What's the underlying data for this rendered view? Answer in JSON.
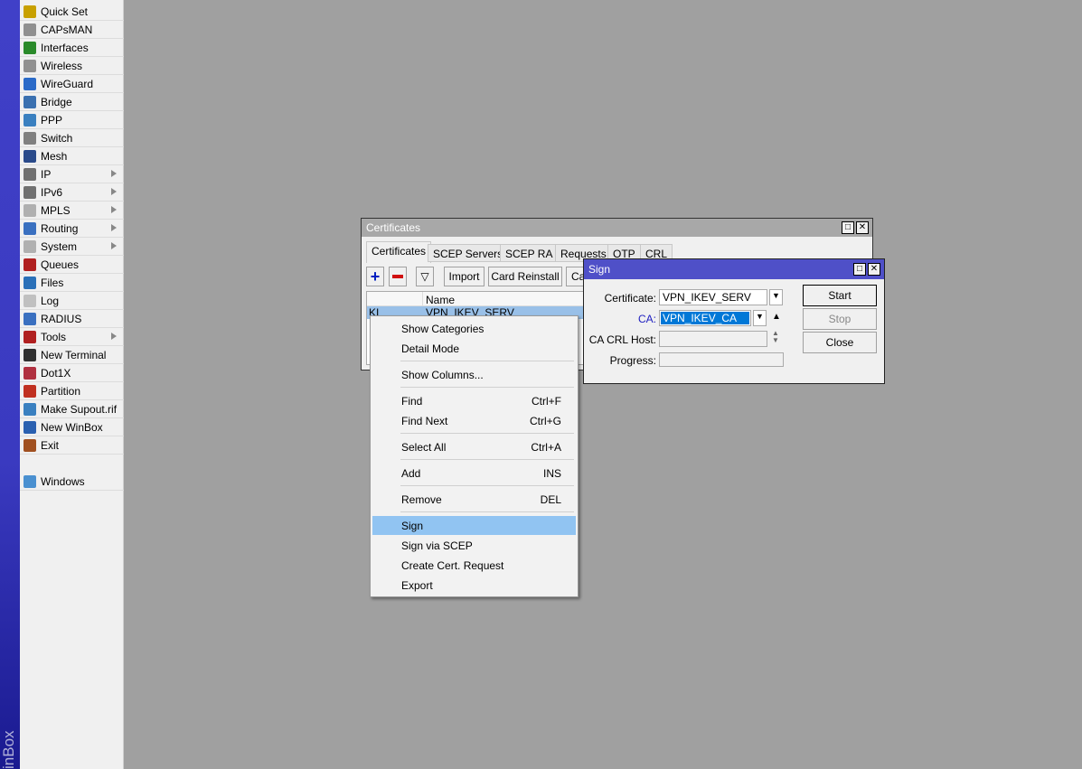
{
  "sidebar": {
    "brand": "inBox",
    "items": [
      {
        "label": "Quick Set",
        "icon": "quick-set-icon",
        "color": "#c8a000",
        "sub": false
      },
      {
        "label": "CAPsMAN",
        "icon": "capsman-icon",
        "color": "#909090",
        "sub": false
      },
      {
        "label": "Interfaces",
        "icon": "interfaces-icon",
        "color": "#2a8a2a",
        "sub": false
      },
      {
        "label": "Wireless",
        "icon": "wireless-icon",
        "color": "#909090",
        "sub": false
      },
      {
        "label": "WireGuard",
        "icon": "wireguard-icon",
        "color": "#2a6ac8",
        "sub": false
      },
      {
        "label": "Bridge",
        "icon": "bridge-icon",
        "color": "#3a70b0",
        "sub": false
      },
      {
        "label": "PPP",
        "icon": "ppp-icon",
        "color": "#3a80c0",
        "sub": false
      },
      {
        "label": "Switch",
        "icon": "switch-icon",
        "color": "#808080",
        "sub": false
      },
      {
        "label": "Mesh",
        "icon": "mesh-icon",
        "color": "#2a4a8a",
        "sub": false
      },
      {
        "label": "IP",
        "icon": "ip-icon",
        "color": "#707070",
        "sub": true
      },
      {
        "label": "IPv6",
        "icon": "ipv6-icon",
        "color": "#707070",
        "sub": true
      },
      {
        "label": "MPLS",
        "icon": "mpls-icon",
        "color": "#b0b0b0",
        "sub": true
      },
      {
        "label": "Routing",
        "icon": "routing-icon",
        "color": "#3a70c0",
        "sub": true
      },
      {
        "label": "System",
        "icon": "system-icon",
        "color": "#b0b0b0",
        "sub": true
      },
      {
        "label": "Queues",
        "icon": "queues-icon",
        "color": "#b02020",
        "sub": false
      },
      {
        "label": "Files",
        "icon": "files-icon",
        "color": "#2a70b8",
        "sub": false
      },
      {
        "label": "Log",
        "icon": "log-icon",
        "color": "#c0c0c0",
        "sub": false
      },
      {
        "label": "RADIUS",
        "icon": "radius-icon",
        "color": "#3a70c0",
        "sub": false
      },
      {
        "label": "Tools",
        "icon": "tools-icon",
        "color": "#b02020",
        "sub": true
      },
      {
        "label": "New Terminal",
        "icon": "terminal-icon",
        "color": "#303030",
        "sub": false
      },
      {
        "label": "Dot1X",
        "icon": "dot1x-icon",
        "color": "#b03040",
        "sub": false
      },
      {
        "label": "Partition",
        "icon": "partition-icon",
        "color": "#c03020",
        "sub": false
      },
      {
        "label": "Make Supout.rif",
        "icon": "supout-icon",
        "color": "#3a80c0",
        "sub": false
      },
      {
        "label": "New WinBox",
        "icon": "winbox-icon",
        "color": "#2a60b0",
        "sub": false
      },
      {
        "label": "Exit",
        "icon": "exit-icon",
        "color": "#a05020",
        "sub": false
      }
    ],
    "windows": {
      "label": "Windows",
      "icon": "windows-icon",
      "color": "#4a90d0"
    }
  },
  "certs": {
    "title": "Certificates",
    "tabs": [
      "Certificates",
      "SCEP Servers",
      "SCEP RA",
      "Requests",
      "OTP",
      "CRL"
    ],
    "toolbar": {
      "import": "Import",
      "card_reinstall": "Card Reinstall",
      "ca": "Ca"
    },
    "columns": [
      "",
      "Name"
    ],
    "rows": [
      {
        "flags": "KI",
        "name": "VPN_IKEV_SERV"
      }
    ]
  },
  "context_menu": {
    "items": [
      {
        "label": "Show Categories",
        "shortcut": ""
      },
      {
        "label": "Detail Mode",
        "shortcut": ""
      },
      {
        "label": "Show Columns...",
        "shortcut": ""
      },
      {
        "label": "Find",
        "shortcut": "Ctrl+F"
      },
      {
        "label": "Find Next",
        "shortcut": "Ctrl+G"
      },
      {
        "label": "Select All",
        "shortcut": "Ctrl+A"
      },
      {
        "label": "Add",
        "shortcut": "INS"
      },
      {
        "label": "Remove",
        "shortcut": "DEL"
      },
      {
        "label": "Sign",
        "shortcut": ""
      },
      {
        "label": "Sign via SCEP",
        "shortcut": ""
      },
      {
        "label": "Create Cert. Request",
        "shortcut": ""
      },
      {
        "label": "Export",
        "shortcut": ""
      }
    ],
    "highlighted": "Sign"
  },
  "sign": {
    "title": "Sign",
    "certificate_label": "Certificate:",
    "certificate": "VPN_IKEV_SERV",
    "ca_label": "CA:",
    "ca": "VPN_IKEV_CA",
    "crl_label": "CA CRL Host:",
    "crl": "",
    "progress_label": "Progress:",
    "progress": "",
    "start": "Start",
    "stop": "Stop",
    "close": "Close"
  }
}
